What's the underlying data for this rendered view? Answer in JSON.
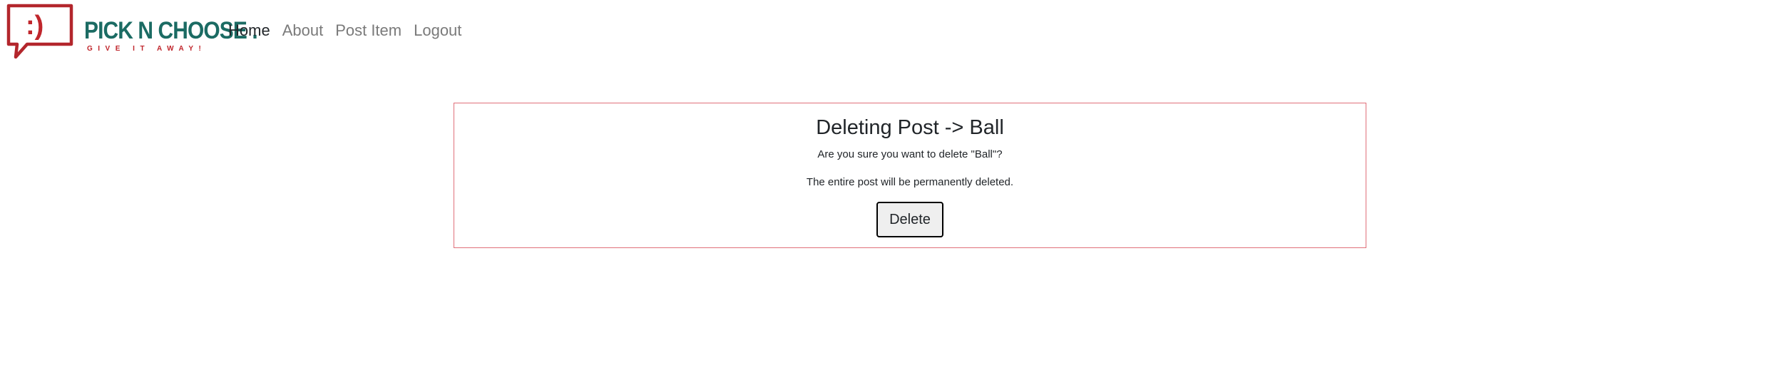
{
  "brand": {
    "name": "PICK N CHOOSE .",
    "tagline": "GIVE IT AWAY!",
    "logo_icon": "speech-bubble-smiley-icon",
    "logo_glyph": ":)",
    "primary_color": "#1b6b63",
    "accent_color": "#c0262c"
  },
  "nav": {
    "items": [
      {
        "label": "Home",
        "active": true
      },
      {
        "label": "About",
        "active": false
      },
      {
        "label": "Post Item",
        "active": false
      },
      {
        "label": "Logout",
        "active": false
      }
    ]
  },
  "delete_dialog": {
    "title": "Deleting Post -> Ball",
    "question": "Are you sure you want to delete \"Ball\"?",
    "warning": "The entire post will be permanently deleted.",
    "button_label": "Delete",
    "border_color": "#e0707a"
  }
}
